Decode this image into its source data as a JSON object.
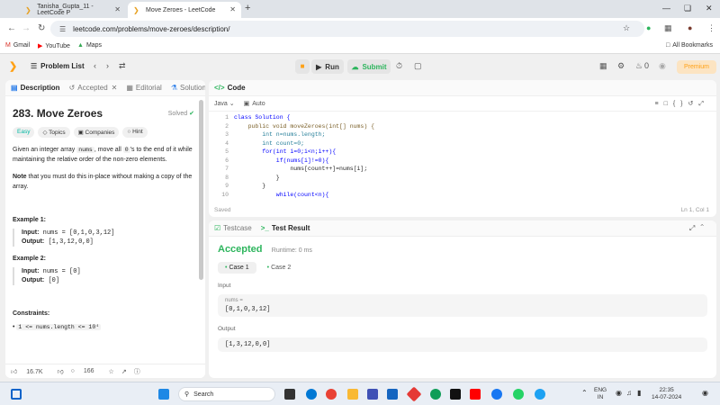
{
  "browser": {
    "tabs": [
      {
        "title": "Tanisha_Gupta_11 - LeetCode P"
      },
      {
        "title": "Move Zeroes - LeetCode"
      }
    ],
    "url": "leetcode.com/problems/move-zeroes/description/",
    "bookmarks": [
      {
        "label": "Gmail",
        "icon": "gmail-icon"
      },
      {
        "label": "YouTube",
        "icon": "youtube-icon"
      },
      {
        "label": "Maps",
        "icon": "maps-icon"
      }
    ],
    "all_bookmarks": "All Bookmarks"
  },
  "header": {
    "problem_list": "Problem List",
    "run": "Run",
    "submit": "Submit",
    "streak": "0",
    "premium": "Premium"
  },
  "left": {
    "tabs": [
      {
        "label": "Description"
      },
      {
        "label": "Accepted"
      },
      {
        "label": "Editorial"
      },
      {
        "label": "Solutions"
      }
    ],
    "title": "283. Move Zeroes",
    "solved": "Solved",
    "chips": [
      {
        "label": "Easy"
      },
      {
        "label": "Topics"
      },
      {
        "label": "Companies"
      },
      {
        "label": "Hint"
      }
    ],
    "desc_1": "Given an integer array",
    "desc_code": "nums",
    "desc_2": ", move all",
    "desc_code2": "0",
    "desc_3": "'s to the end of it while maintaining the relative order of the non-zero elements.",
    "note_bold": "Note",
    "note_rest": "that you must do this in-place without making a copy of the array.",
    "example1_head": "Example 1:",
    "example1_input_label": "Input:",
    "example1_input": "nums = [0,1,0,3,12]",
    "example1_output_label": "Output:",
    "example1_output": "[1,3,12,0,0]",
    "example2_head": "Example 2:",
    "example2_input_label": "Input:",
    "example2_input": "nums = [0]",
    "example2_output_label": "Output:",
    "example2_output": "[0]",
    "constraints_head": "Constraints:",
    "constraint_1": "1 <= nums.length <= 10⁴",
    "footer": {
      "likes": "16.7K",
      "comments": "166"
    }
  },
  "code": {
    "title": "Code",
    "language": "Java",
    "mode": "Auto",
    "saved": "Saved",
    "position": "Ln 1, Col 1",
    "line_numbers": [
      "1",
      "2",
      "3",
      "4",
      "5",
      "6",
      "7",
      "8",
      "9",
      "10"
    ],
    "lines": [
      "class Solution {",
      "    public void moveZeroes(int[] nums) {",
      "        int n=nums.length;",
      "        int count=0;",
      "        for(int i=0;i<n;i++){",
      "            if(nums[i]!=0){",
      "                nums[count++]=nums[i];",
      "            }",
      "        }",
      "            while(count<n){"
    ]
  },
  "result": {
    "tabs": [
      {
        "label": "Testcase"
      },
      {
        "label": "Test Result"
      }
    ],
    "status": "Accepted",
    "runtime": "Runtime: 0 ms",
    "cases": [
      {
        "label": "Case 1"
      },
      {
        "label": "Case 2"
      }
    ],
    "input_label": "Input",
    "input_var": "nums =",
    "input_value": "[0,1,0,3,12]",
    "output_label": "Output",
    "output_value": "[1,3,12,0,0]"
  },
  "taskbar": {
    "search": "Search",
    "lang_1": "ENG",
    "lang_2": "IN",
    "time": "22:35",
    "date": "14-07-2024"
  }
}
